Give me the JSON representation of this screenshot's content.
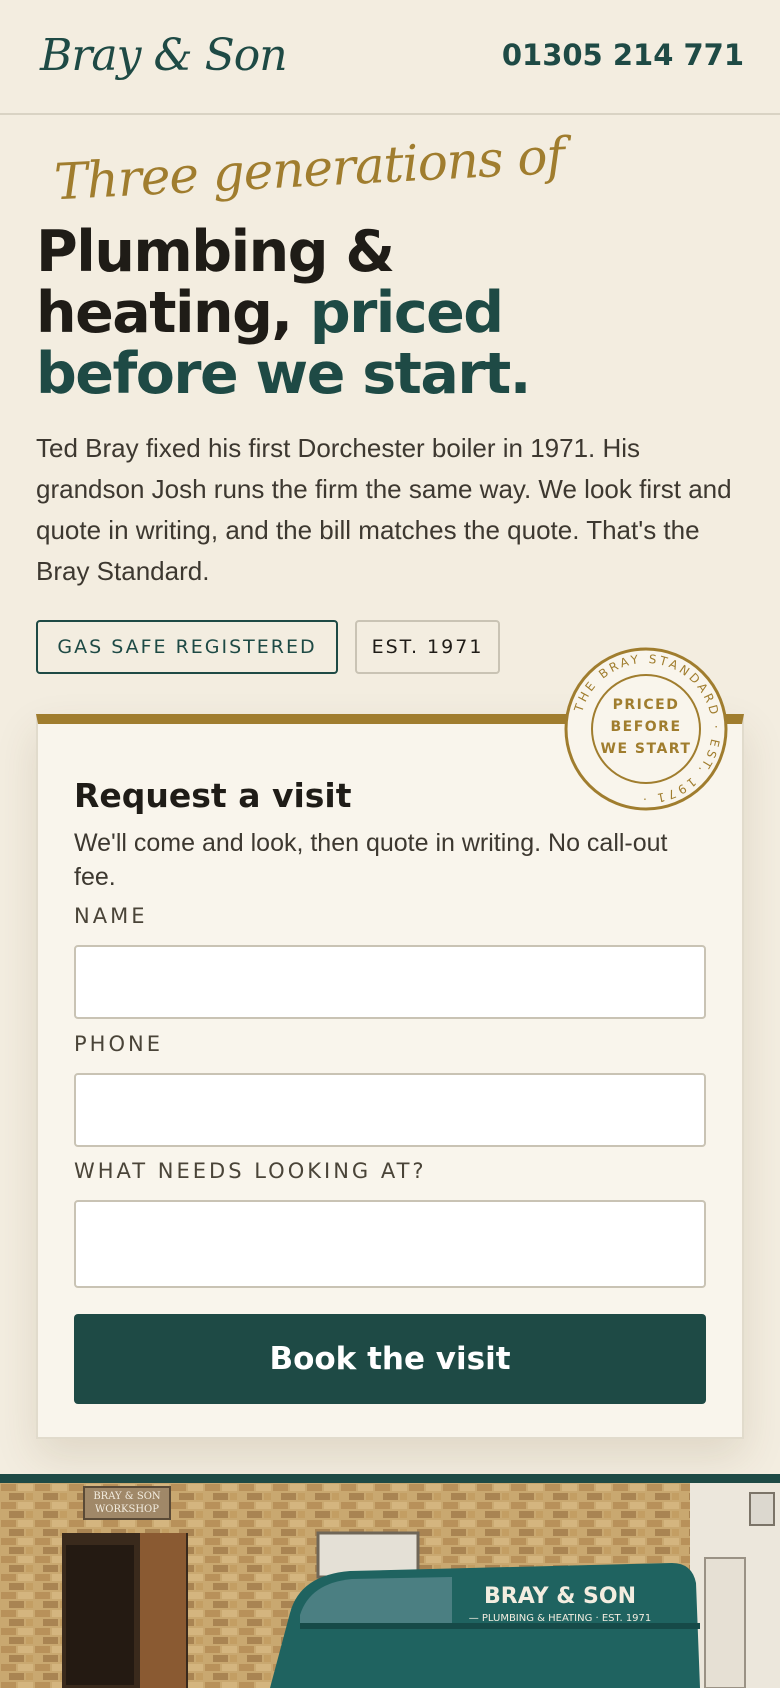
{
  "header": {
    "logo": "Bray & Son",
    "phone": "01305 214 771"
  },
  "hero": {
    "script_line": "Three generations of",
    "headline_part1": "Plumbing & heating,",
    "headline_accent": "priced before we start.",
    "intro": "Ted Bray fixed his first Dorchester boiler in 1971. His grandson Josh runs the firm the same way. We look first and quote in writing, and the bill matches the quote. That's the Bray Standard.",
    "badges": [
      "GAS SAFE REGISTERED",
      "EST. 1971"
    ]
  },
  "stamp": {
    "center_line1": "PRICED",
    "center_line2": "BEFORE",
    "center_line3": "WE START",
    "ring_text": "THE BRAY STANDARD · EST. 1971 ·"
  },
  "form": {
    "title": "Request a visit",
    "subtitle": "We'll come and look, then quote in writing. No call-out fee.",
    "name_label": "NAME",
    "name_value": "",
    "phone_label": "PHONE",
    "phone_value": "",
    "issue_label": "WHAT NEEDS LOOKING AT?",
    "issue_value": "",
    "submit_label": "Book the visit"
  },
  "photo": {
    "workshop_sign_line1": "BRAY & SON",
    "workshop_sign_line2": "WORKSHOP",
    "van_line1": "BRAY & SON",
    "van_line2": "— PLUMBING & HEATING · EST. 1971"
  },
  "colors": {
    "background": "#f3ede0",
    "brand_green": "#1e4a45",
    "gold": "#a07d2e",
    "card": "#f9f5ec"
  }
}
